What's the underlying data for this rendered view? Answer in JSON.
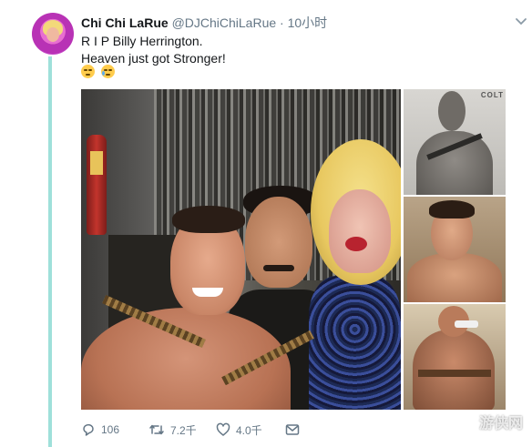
{
  "tweet": {
    "author": {
      "display_name": "Chi Chi LaRue",
      "handle": "@DJChiChiLaRue"
    },
    "separator": "·",
    "timestamp": "10小时",
    "lines": [
      "R I P Billy Herrington.",
      "Heaven just got Stronger!"
    ],
    "emojis": [
      "relieved-face",
      "crying-face"
    ],
    "media": {
      "images": [
        "group-photo",
        "side-photo-1",
        "side-photo-2",
        "side-photo-3"
      ],
      "side_photo_1_text": "COLT"
    },
    "actions": {
      "reply": {
        "icon": "reply-icon",
        "count": "106"
      },
      "retweet": {
        "icon": "retweet-icon",
        "count": "7.2千"
      },
      "like": {
        "icon": "heart-icon",
        "count": "4.0千"
      },
      "message": {
        "icon": "envelope-icon"
      }
    }
  },
  "watermark": {
    "text": "游侠网"
  },
  "colors": {
    "thread_line": "#9fe0da",
    "text_primary": "#14171a",
    "text_secondary": "#657786"
  }
}
